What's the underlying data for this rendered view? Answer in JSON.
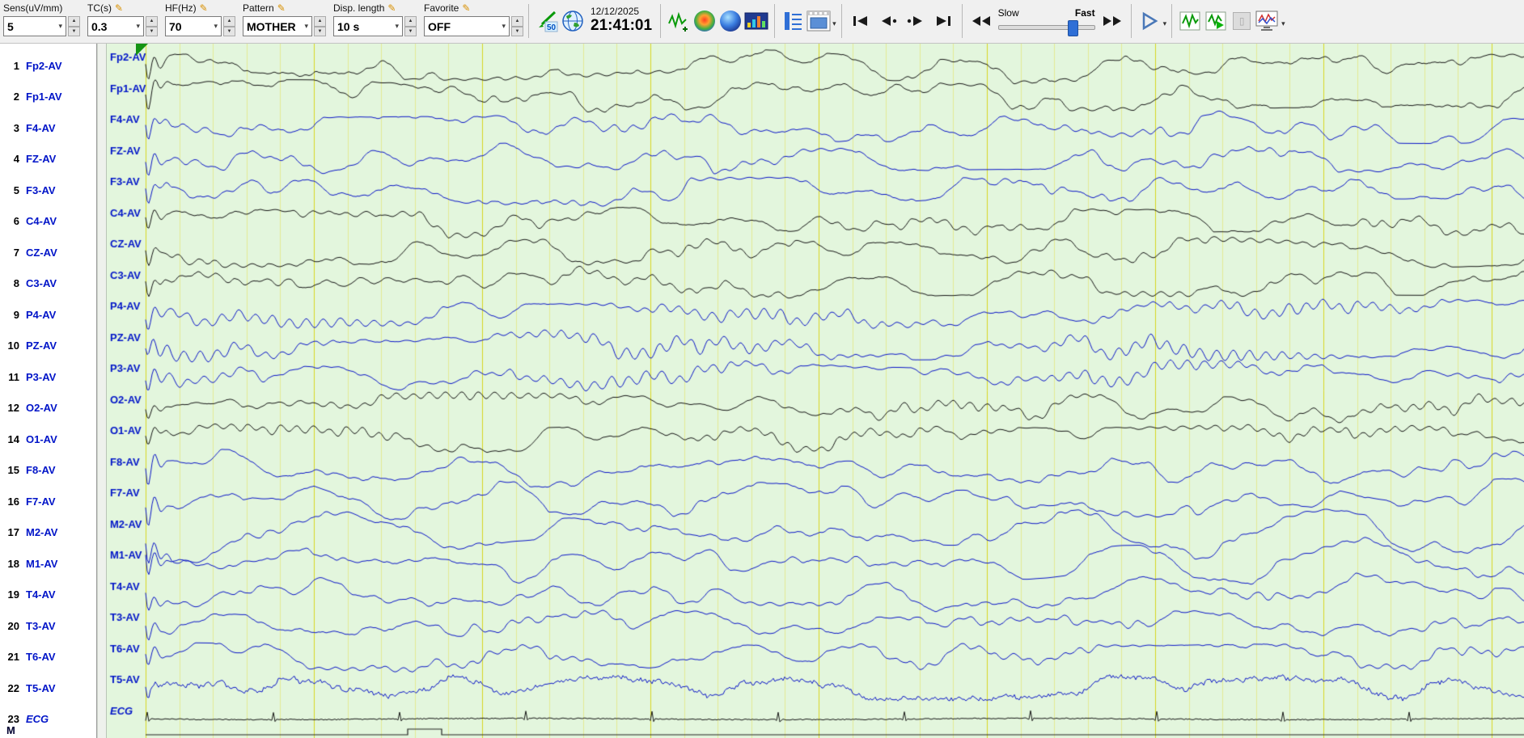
{
  "toolbar": {
    "groups": [
      {
        "id": "sens",
        "label": "Sens(uV/mm)",
        "value": "5",
        "pencil": false
      },
      {
        "id": "tc",
        "label": "TC(s)",
        "value": "0.3",
        "pencil": true
      },
      {
        "id": "hf",
        "label": "HF(Hz)",
        "value": "70",
        "pencil": true
      },
      {
        "id": "pattern",
        "label": "Pattern",
        "value": "MOTHER",
        "pencil": true
      },
      {
        "id": "disp-length",
        "label": "Disp. length",
        "value": "10 s",
        "pencil": true
      },
      {
        "id": "favorite",
        "label": "Favorite",
        "value": "OFF",
        "pencil": true
      }
    ],
    "notch_badge": "50",
    "datetime": {
      "date": "12/12/2025",
      "time": "21:41:01"
    },
    "speed": {
      "slow_label": "Slow",
      "fast_label": "Fast"
    }
  },
  "icons": {
    "pencil": "✎",
    "chevron_down": "▾",
    "spin_up": "▲",
    "spin_down": "▼"
  },
  "channels": [
    {
      "num": "1",
      "label": "Fp2-AV",
      "color": "black"
    },
    {
      "num": "2",
      "label": "Fp1-AV",
      "color": "black"
    },
    {
      "num": "3",
      "label": "F4-AV",
      "color": "blue"
    },
    {
      "num": "4",
      "label": "FZ-AV",
      "color": "blue"
    },
    {
      "num": "5",
      "label": "F3-AV",
      "color": "blue"
    },
    {
      "num": "6",
      "label": "C4-AV",
      "color": "black"
    },
    {
      "num": "7",
      "label": "CZ-AV",
      "color": "black"
    },
    {
      "num": "8",
      "label": "C3-AV",
      "color": "black"
    },
    {
      "num": "9",
      "label": "P4-AV",
      "color": "blue"
    },
    {
      "num": "10",
      "label": "PZ-AV",
      "color": "blue"
    },
    {
      "num": "11",
      "label": "P3-AV",
      "color": "blue"
    },
    {
      "num": "12",
      "label": "O2-AV",
      "color": "black"
    },
    {
      "num": "14",
      "label": "O1-AV",
      "color": "black"
    },
    {
      "num": "15",
      "label": "F8-AV",
      "color": "blue"
    },
    {
      "num": "16",
      "label": "F7-AV",
      "color": "blue"
    },
    {
      "num": "17",
      "label": "M2-AV",
      "color": "blue"
    },
    {
      "num": "18",
      "label": "M1-AV",
      "color": "blue"
    },
    {
      "num": "19",
      "label": "T4-AV",
      "color": "blue"
    },
    {
      "num": "20",
      "label": "T3-AV",
      "color": "blue"
    },
    {
      "num": "21",
      "label": "T6-AV",
      "color": "blue"
    },
    {
      "num": "22",
      "label": "T5-AV",
      "color": "blue",
      "italic": false
    },
    {
      "num": "23",
      "label": "ECG",
      "color": "black",
      "italic": true
    }
  ],
  "bottom_row_label": "M",
  "colors": {
    "trace_black": "#161616",
    "trace_blue": "#0b16c8",
    "channel_label": "#0014c8",
    "bg_trace_area": "#e3f6dd",
    "grid_minor": "rgba(226,222,60,0.45)",
    "grid_major": "rgba(214,208,0,0.85)",
    "marker_green": "#159415"
  }
}
